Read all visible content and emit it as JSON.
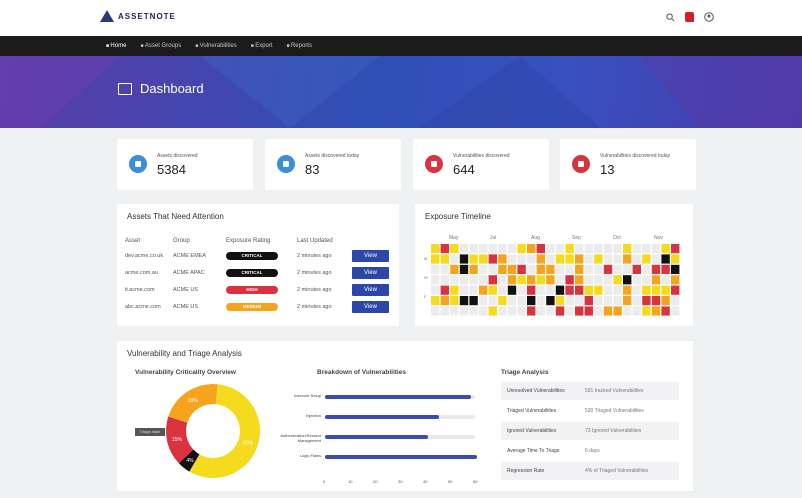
{
  "app": {
    "name": "ASSETNOTE"
  },
  "nav": [
    {
      "label": "Home",
      "active": true
    },
    {
      "label": "Asset Groups",
      "active": false
    },
    {
      "label": "Vulnerabilities",
      "active": false
    },
    {
      "label": "Export",
      "active": false
    },
    {
      "label": "Reports",
      "active": false
    }
  ],
  "header": {
    "title": "Dashboard"
  },
  "stats": [
    {
      "label": "Assets discovered",
      "value": "5384",
      "color": "#3a8fd8"
    },
    {
      "label": "Assets discovered today",
      "value": "83",
      "color": "#3a8fd8"
    },
    {
      "label": "Vulnerabilities discovered",
      "value": "644",
      "color": "#d8333f"
    },
    {
      "label": "Vulnerabilities discovered today",
      "value": "13",
      "color": "#d8333f"
    }
  ],
  "assets_panel": {
    "title": "Assets That Need Attention",
    "columns": [
      "Asset",
      "Group",
      "Exposure Rating",
      "Last Updated",
      ""
    ],
    "rows": [
      {
        "asset": "dev.acme.co.uk",
        "group": "ACME EMEA",
        "rating": "CRITICAL",
        "rating_color": "#111111",
        "updated": "2 minutes ago",
        "action": "View"
      },
      {
        "asset": "acme.com.au",
        "group": "ACME APAC",
        "rating": "CRITICAL",
        "rating_color": "#111111",
        "updated": "2 minutes ago",
        "action": "View"
      },
      {
        "asset": "it.acme.com",
        "group": "ACME US",
        "rating": "HIGH",
        "rating_color": "#d8333f",
        "updated": "2 minutes ago",
        "action": "View"
      },
      {
        "asset": "abc.acme.com",
        "group": "ACME US",
        "rating": "MEDIUM",
        "rating_color": "#f5a51d",
        "updated": "2 minutes ago",
        "action": "View"
      }
    ]
  },
  "timeline": {
    "title": "Exposure Timeline",
    "months": [
      "May",
      "Jul",
      "Aug",
      "Sep",
      "Oct",
      "Nov"
    ],
    "row_labels": [
      "M",
      "W",
      "F"
    ]
  },
  "analysis": {
    "title": "Vulnerability and Triage Analysis",
    "criticality": {
      "title": "Vulnerability Criticality Overview",
      "tooltip": "Triage.state",
      "segments": [
        {
          "label": "50%",
          "value": 50,
          "color": "#f5da1d"
        },
        {
          "label": "4%",
          "value": 4,
          "color": "#111111"
        },
        {
          "label": "15%",
          "value": 15,
          "color": "#d8333f"
        },
        {
          "label": "19%",
          "value": 19,
          "color": "#f5a51d"
        }
      ]
    },
    "breakdown": {
      "title": "Breakdown of Vulnerabilities",
      "bars": [
        {
          "label": "Insecure Setup",
          "value": 68
        },
        {
          "label": "Injection",
          "value": 53
        },
        {
          "label": "Authentication/Session Management",
          "value": 48
        },
        {
          "label": "Logic Flaws",
          "value": 71
        }
      ],
      "ticks": [
        "0",
        "10",
        "20",
        "30",
        "40",
        "50",
        "60"
      ]
    },
    "triage": {
      "title": "Triage Analysis",
      "rows": [
        {
          "key": "Unresolved Vulnerabilities",
          "value": "591 tracked Vulnerabilities"
        },
        {
          "key": "Triaged Vulnerabilities",
          "value": "520 Triaged Vulnerabilities"
        },
        {
          "key": "Ignored Vulnerabilities",
          "value": "73 Ignored Vulnerabilities"
        },
        {
          "key": "Average Time To Triage",
          "value": "6 days"
        },
        {
          "key": "Regression Rate",
          "value": "4% of Triaged Vulnerabilities"
        }
      ]
    }
  }
}
